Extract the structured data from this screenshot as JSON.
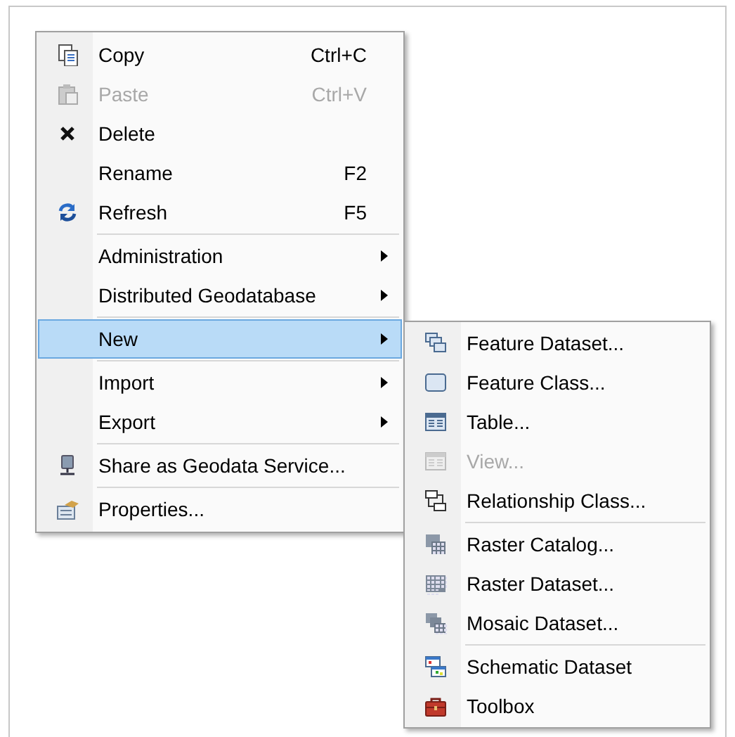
{
  "context_menu": {
    "groups": [
      [
        {
          "label": "Copy",
          "shortcut": "Ctrl+C",
          "disabled": false,
          "selected": false,
          "submenu": false
        },
        {
          "label": "Paste",
          "shortcut": "Ctrl+V",
          "disabled": true,
          "selected": false,
          "submenu": false
        },
        {
          "label": "Delete",
          "disabled": false,
          "selected": false,
          "submenu": false
        },
        {
          "label": "Rename",
          "shortcut": "F2",
          "disabled": false,
          "selected": false,
          "submenu": false
        },
        {
          "label": "Refresh",
          "shortcut": "F5",
          "disabled": false,
          "selected": false,
          "submenu": false
        }
      ],
      [
        {
          "label": "Administration",
          "disabled": false,
          "selected": false,
          "submenu": true
        },
        {
          "label": "Distributed Geodatabase",
          "disabled": false,
          "selected": false,
          "submenu": true
        }
      ],
      [
        {
          "label": "New",
          "disabled": false,
          "selected": true,
          "submenu": true
        }
      ],
      [
        {
          "label": "Import",
          "disabled": false,
          "selected": false,
          "submenu": true
        },
        {
          "label": "Export",
          "disabled": false,
          "selected": false,
          "submenu": true
        }
      ],
      [
        {
          "label": "Share as Geodata Service...",
          "disabled": false,
          "selected": false,
          "submenu": false
        }
      ],
      [
        {
          "label": "Properties...",
          "disabled": false,
          "selected": false,
          "submenu": false
        }
      ]
    ]
  },
  "new_submenu": {
    "groups": [
      [
        {
          "label": "Feature Dataset...",
          "disabled": false
        },
        {
          "label": "Feature Class...",
          "disabled": false
        },
        {
          "label": "Table...",
          "disabled": false
        },
        {
          "label": "View...",
          "disabled": true
        },
        {
          "label": "Relationship Class...",
          "disabled": false
        }
      ],
      [
        {
          "label": "Raster Catalog...",
          "disabled": false
        },
        {
          "label": "Raster Dataset...",
          "disabled": false
        },
        {
          "label": "Mosaic Dataset...",
          "disabled": false
        }
      ],
      [
        {
          "label": "Schematic Dataset",
          "disabled": false
        },
        {
          "label": "Toolbox",
          "disabled": false
        }
      ]
    ]
  }
}
